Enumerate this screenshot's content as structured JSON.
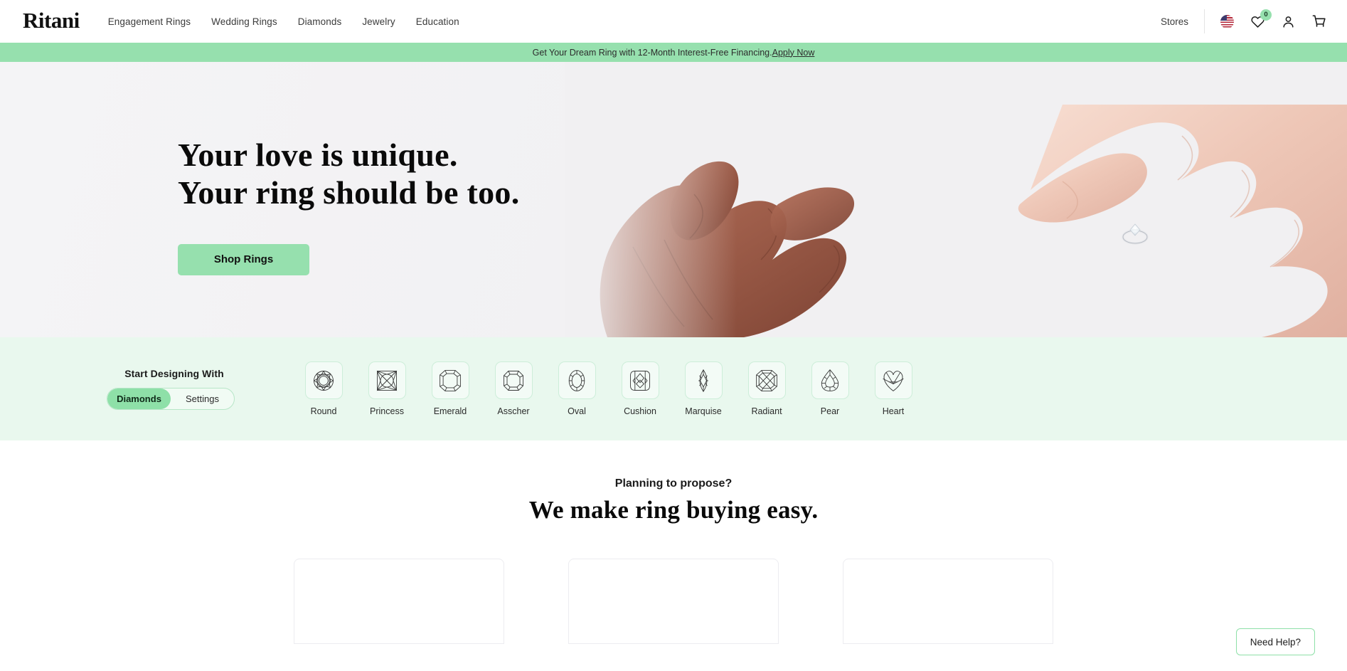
{
  "header": {
    "logo": "Ritani",
    "nav": [
      {
        "label": "Engagement Rings"
      },
      {
        "label": "Wedding Rings"
      },
      {
        "label": "Diamonds"
      },
      {
        "label": "Jewelry"
      },
      {
        "label": "Education"
      }
    ],
    "stores_label": "Stores",
    "locale_icon": "us-flag-icon",
    "favorites_icon": "heart-icon",
    "favorites_count": "0",
    "account_icon": "account-person-icon",
    "cart_icon": "shopping-cart-icon"
  },
  "promo": {
    "text": "Get Your Dream Ring with 12-Month Interest-Free Financing. ",
    "link_label": "Apply Now"
  },
  "hero": {
    "title": "Your love is unique.\nYour ring should be too.",
    "cta_label": "Shop Rings",
    "image_alt": "two-hands-engagement-ring"
  },
  "designer": {
    "label": "Start Designing With",
    "toggle": [
      {
        "label": "Diamonds",
        "active": true
      },
      {
        "label": "Settings",
        "active": false
      }
    ],
    "shapes": [
      {
        "label": "Round",
        "icon": "round-diamond-icon"
      },
      {
        "label": "Princess",
        "icon": "princess-diamond-icon"
      },
      {
        "label": "Emerald",
        "icon": "emerald-diamond-icon"
      },
      {
        "label": "Asscher",
        "icon": "asscher-diamond-icon"
      },
      {
        "label": "Oval",
        "icon": "oval-diamond-icon"
      },
      {
        "label": "Cushion",
        "icon": "cushion-diamond-icon"
      },
      {
        "label": "Marquise",
        "icon": "marquise-diamond-icon"
      },
      {
        "label": "Radiant",
        "icon": "radiant-diamond-icon"
      },
      {
        "label": "Pear",
        "icon": "pear-diamond-icon"
      },
      {
        "label": "Heart",
        "icon": "heart-diamond-icon"
      }
    ]
  },
  "propose": {
    "kicker": "Planning to propose?",
    "title": "We make ring buying easy."
  },
  "support": {
    "need_help_label": "Need Help?"
  },
  "colors": {
    "brand_green": "#96e0ae",
    "mint_band": "#e9f8ee",
    "hero_bg": "#f1f0f2",
    "text_dark": "#111111"
  }
}
